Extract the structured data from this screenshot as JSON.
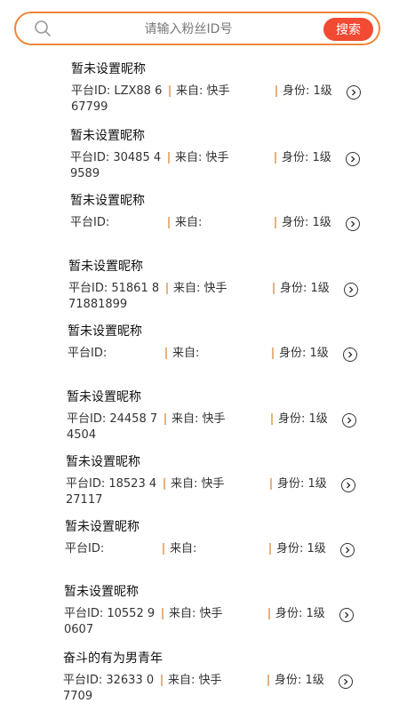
{
  "search": {
    "placeholder": "请输入粉丝ID号",
    "button": "搜索"
  },
  "labels": {
    "platform_id": "平台ID:",
    "from": "来自:",
    "identity": "身份:"
  },
  "fans": [
    {
      "nickname": "暂未设置昵称",
      "platform_id": "LZX88 667799",
      "from": "快手",
      "level": "1级"
    },
    {
      "nickname": "暂未设置昵称",
      "platform_id": "30485 49589",
      "from": "快手",
      "level": "1级"
    },
    {
      "nickname": "暂未设置昵称",
      "platform_id": "",
      "from": "",
      "level": "1级"
    },
    {
      "nickname": "暂未设置昵称",
      "platform_id": "51861 871881899",
      "from": "快手",
      "level": "1级"
    },
    {
      "nickname": "暂未设置昵称",
      "platform_id": "",
      "from": "",
      "level": "1级"
    },
    {
      "nickname": "暂未设置昵称",
      "platform_id": "24458 74504",
      "from": "快手",
      "level": "1级"
    },
    {
      "nickname": "暂未设置昵称",
      "platform_id": "18523 427117",
      "from": "快手",
      "level": "1级"
    },
    {
      "nickname": "暂未设置昵称",
      "platform_id": "",
      "from": "",
      "level": "1级"
    },
    {
      "nickname": "暂未设置昵称",
      "platform_id": "10552 90607",
      "from": "快手",
      "level": "1级"
    },
    {
      "nickname": "奋斗的有为男青年",
      "platform_id": "32633 07709",
      "from": "快手",
      "level": "1级"
    }
  ]
}
